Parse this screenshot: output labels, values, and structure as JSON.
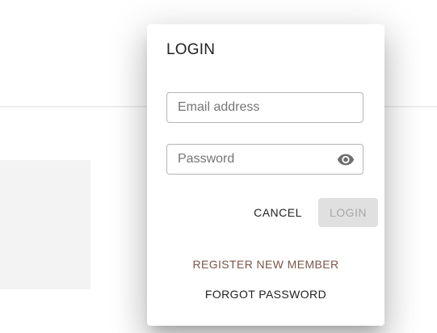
{
  "dialog": {
    "title": "LOGIN",
    "email": {
      "placeholder": "Email address",
      "value": ""
    },
    "password": {
      "placeholder": "Password",
      "value": "",
      "toggle_icon": "eye-icon"
    },
    "actions": {
      "cancel_label": "CANCEL",
      "login_label": "LOGIN"
    },
    "links": {
      "register_label": "REGISTER NEW MEMBER",
      "forgot_label": "FORGOT PASSWORD"
    }
  },
  "colors": {
    "link_accent": "#795548",
    "disabled_button_bg": "#e0e0e0",
    "disabled_button_text": "#a6a6a6",
    "field_border": "#b5b5b5"
  }
}
